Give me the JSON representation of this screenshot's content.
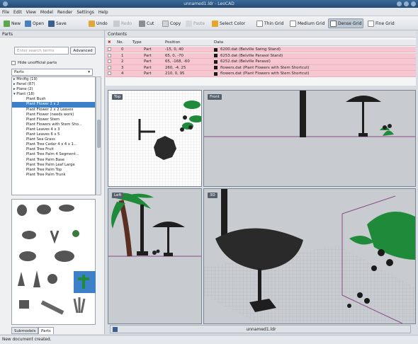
{
  "window": {
    "title": "unnamed1.ldr - LeoCAD"
  },
  "menu": [
    "File",
    "Edit",
    "View",
    "Model",
    "Render",
    "Settings",
    "Help"
  ],
  "toolbar": {
    "new": "New",
    "open": "Open",
    "save": "Save",
    "undo": "Undo",
    "redo": "Redo",
    "cut": "Cut",
    "copy": "Copy",
    "paste": "Paste",
    "select_color": "Select Color",
    "thin_grid": "Thin Grid",
    "medium_grid": "Medium Grid",
    "dense_grid": "Dense Grid",
    "fine_grid": "Fine Grid"
  },
  "parts_panel": {
    "title": "Parts",
    "search_placeholder": "Enter search terms",
    "advanced_label": "Advanced",
    "hide_unofficial_label": "Hide unofficial parts",
    "category": "Parts",
    "tree": [
      "Minifig (19)",
      "Panel (87)",
      "Plane (2)",
      "Plant (18)",
      "Plant Bush",
      "Plant Flower 2 x 2",
      "Plant Flower 2 x 2 Leaves",
      "Plant Flower (needs work)",
      "Plant Flower Stem",
      "Plant Flowers with Stem Sho...",
      "Plant Leaves 4 x 3",
      "Plant Leaves 6 x 5",
      "Plant Sea Grass",
      "Plant Tree Cedar 4 x 4 x 1...",
      "Plant Tree Fruit",
      "Plant Tree Palm 4 Segment...",
      "Plant Tree Palm Base",
      "Plant Tree Palm Leaf Large",
      "Plant Tree Palm Top",
      "Plant Tree Palm Trunk"
    ],
    "tree_selected_index": 5,
    "tabs": [
      "Submodels",
      "Parts"
    ]
  },
  "contents": {
    "title": "Contents",
    "columns": [
      "No.",
      "Type",
      "Position",
      "Data"
    ],
    "rows": [
      {
        "no": "0",
        "type": "Part",
        "position": "-15, 0, 40",
        "data": "6200.dat (Belville Swing Stand)"
      },
      {
        "no": "1",
        "type": "Part",
        "position": "65, 0, -70",
        "data": "6253.dat (Belville Parasol Stand)"
      },
      {
        "no": "2",
        "type": "Part",
        "position": "65, -168, -60",
        "data": "6252.dat (Belville Parasol)"
      },
      {
        "no": "3",
        "type": "Part",
        "position": "260, -4, 25",
        "data": "flowers.dat (Plant Flowers with Stem Shortcut)"
      },
      {
        "no": "4",
        "type": "Part",
        "position": "210, 0, 95",
        "data": "flowers.dat (Plant Flowers with Stem Shortcut)"
      }
    ]
  },
  "viewports": {
    "top": "Top",
    "front": "Front",
    "left": "Left",
    "3d": "3D"
  },
  "document_tab": "unnamed1.ldr",
  "status": "New document created.",
  "colors": {
    "selection": "#3b80c8",
    "row_pink": "#f6c7d1",
    "dark_part": "#222222",
    "plant_green": "#1f8a3a"
  }
}
